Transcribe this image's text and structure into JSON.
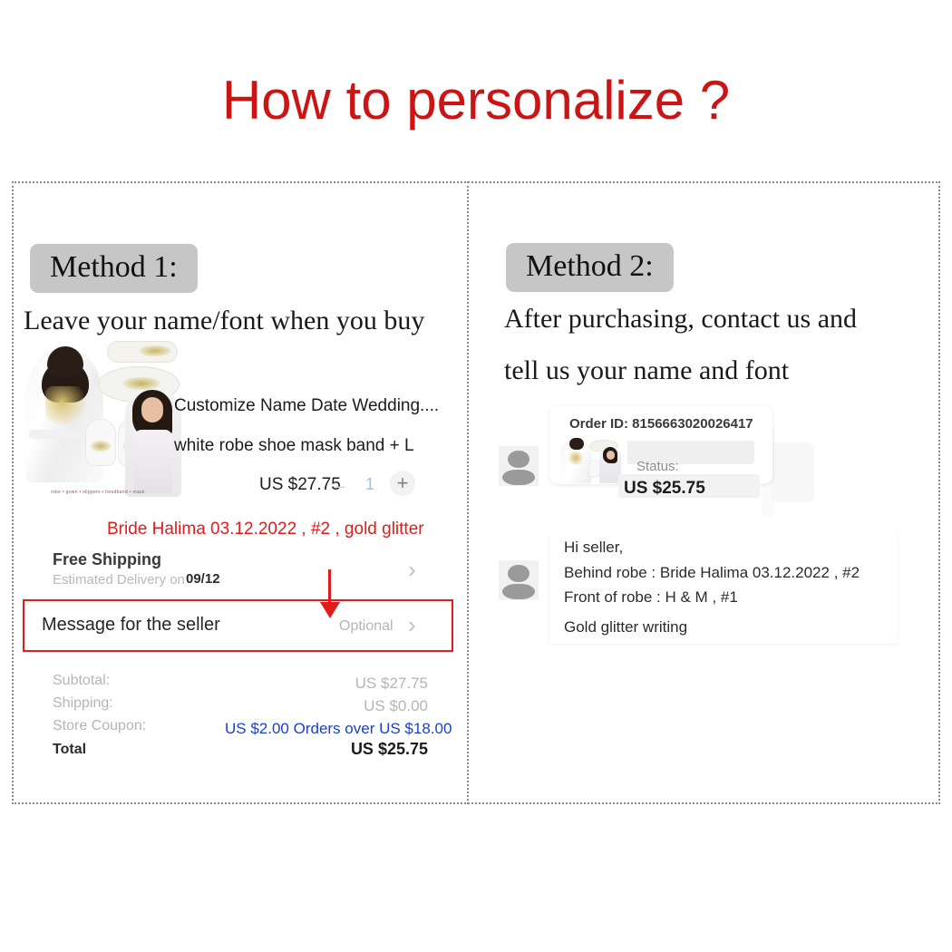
{
  "title": "How to personalize ?",
  "colors": {
    "title_red": "#cc1414",
    "annotation_red": "#e01c1c",
    "coupon_blue": "#1a3fd0",
    "badge_gray": "#c6c6c6"
  },
  "method1": {
    "badge": "Method 1:",
    "subtitle": "Leave your name/font when you buy",
    "order": {
      "product_title": "Customize Name Date Wedding....",
      "product_variant": "white robe shoe mask band + L",
      "price": "US $27.75",
      "qty_minus": "–",
      "qty_value": "1",
      "qty_plus": "+",
      "thumb_caption": "robe • gown • slippers • headband • mask"
    },
    "annotation": "Bride Halima 03.12.2022 ,  #2 ,   gold glitter",
    "shipping": {
      "title": "Free Shipping",
      "subtitle": "Estimated Delivery on",
      "date": "09/12",
      "chevron": "›"
    },
    "message_row": {
      "label": "Message for the seller",
      "hint": "Optional",
      "chevron": "›"
    },
    "totals": [
      {
        "label": "Subtotal:",
        "value": "US $27.75",
        "style": "normal"
      },
      {
        "label": "Shipping:",
        "value": "US $0.00",
        "style": "normal"
      },
      {
        "label": "Store Coupon:",
        "value": "US $2.00 Orders over US $18.00",
        "style": "blue"
      },
      {
        "label": "Total",
        "value": "US $25.75",
        "style": "bold"
      }
    ]
  },
  "method2": {
    "badge": "Method 2:",
    "subtitle_line1": "After purchasing, contact us and",
    "subtitle_line2": "tell us your name and font",
    "order_card": {
      "order_id": "Order ID: 8156663020026417",
      "status_label": "Status:",
      "price": "US $25.75"
    },
    "chat_message": [
      "Hi seller,",
      "Behind robe : Bride Halima 03.12.2022 , #2",
      "Front of  robe : H & M , #1",
      "Gold glitter writing"
    ]
  }
}
